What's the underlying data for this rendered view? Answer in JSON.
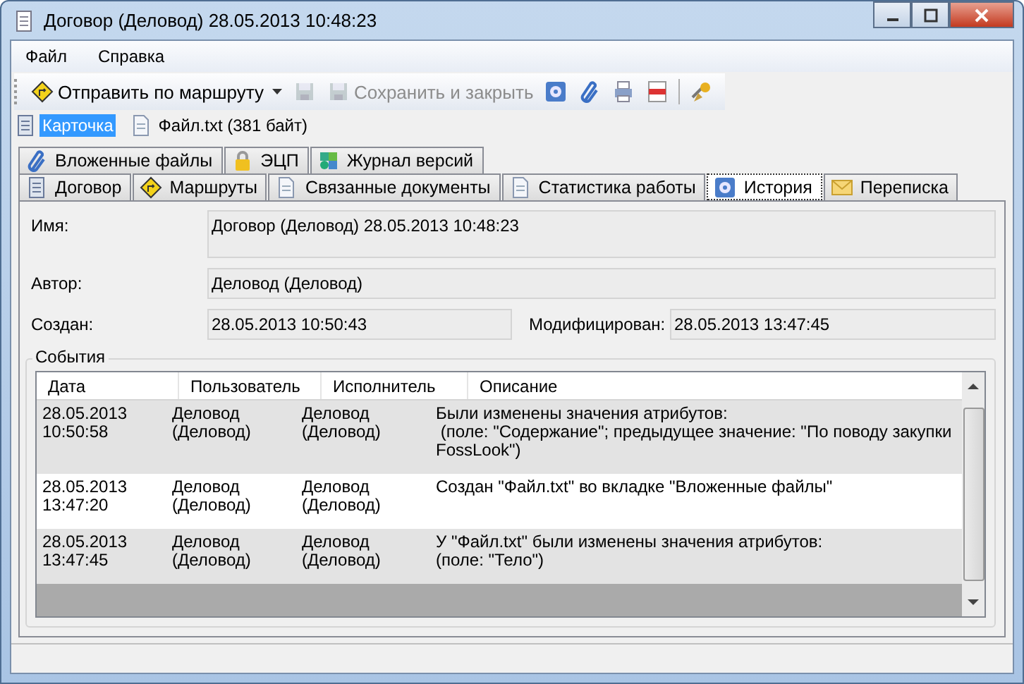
{
  "window": {
    "title": "Договор (Деловод) 28.05.2013 10:48:23"
  },
  "menu": [
    "Файл",
    "Справка"
  ],
  "toolbar": [
    {
      "kind": "dropdown",
      "label": "Отправить по маршруту",
      "disabled": false
    },
    {
      "kind": "icon",
      "disabled": true
    },
    {
      "kind": "labeled",
      "label": "Сохранить и закрыть",
      "disabled": true
    },
    {
      "kind": "icon",
      "disabled": false
    },
    {
      "kind": "icon",
      "disabled": false
    },
    {
      "kind": "icon",
      "disabled": false
    },
    {
      "kind": "icon",
      "disabled": false
    },
    {
      "kind": "separator"
    },
    {
      "kind": "icon",
      "disabled": false
    }
  ],
  "documents": [
    {
      "label": "Карточка",
      "selected": true
    },
    {
      "label": "Файл.txt (381 байт)",
      "selected": false
    }
  ],
  "tab_rows": [
    [
      {
        "label": "Вложенные файлы",
        "selected": false
      },
      {
        "label": "ЭЦП",
        "selected": false
      },
      {
        "label": "Журнал версий",
        "selected": false
      }
    ],
    [
      {
        "label": "Договор",
        "selected": false
      },
      {
        "label": "Маршруты",
        "selected": false
      },
      {
        "label": "Связанные документы",
        "selected": false
      },
      {
        "label": "Статистика работы",
        "selected": false
      },
      {
        "label": "История",
        "selected": true
      },
      {
        "label": "Переписка",
        "selected": false
      }
    ]
  ],
  "fields": {
    "name": {
      "label": "Имя:",
      "value": "Договор (Деловод) 28.05.2013 10:48:23"
    },
    "author": {
      "label": "Автор:",
      "value": "Деловод (Деловод)"
    },
    "created": {
      "label": "Создан:",
      "value": "28.05.2013 10:50:43"
    },
    "modified": {
      "label": "Модифицирован:",
      "value": "28.05.2013 13:47:45"
    }
  },
  "events": {
    "title": "События",
    "columns": [
      "Дата",
      "Пользователь",
      "Исполнитель",
      "Описание"
    ],
    "rows": [
      [
        "28.05.2013\n10:50:58",
        "Деловод\n(Деловод)",
        "Деловод\n(Деловод)",
        "Были изменены значения атрибутов:\n (поле: \"Содержание\"; предыдущее значение: \"По поводу закупки\nFossLook\")"
      ],
      [
        "28.05.2013\n13:47:20",
        "Деловод\n(Деловод)",
        "Деловод\n(Деловод)",
        "Создан \"Файл.txt\" во вкладке \"Вложенные файлы\""
      ],
      [
        "28.05.2013\n13:47:45",
        "Деловод\n(Деловод)",
        "Деловод\n(Деловод)",
        "У \"Файл.txt\" были изменены значения атрибутов:\n(поле: \"Тело\")"
      ]
    ]
  }
}
